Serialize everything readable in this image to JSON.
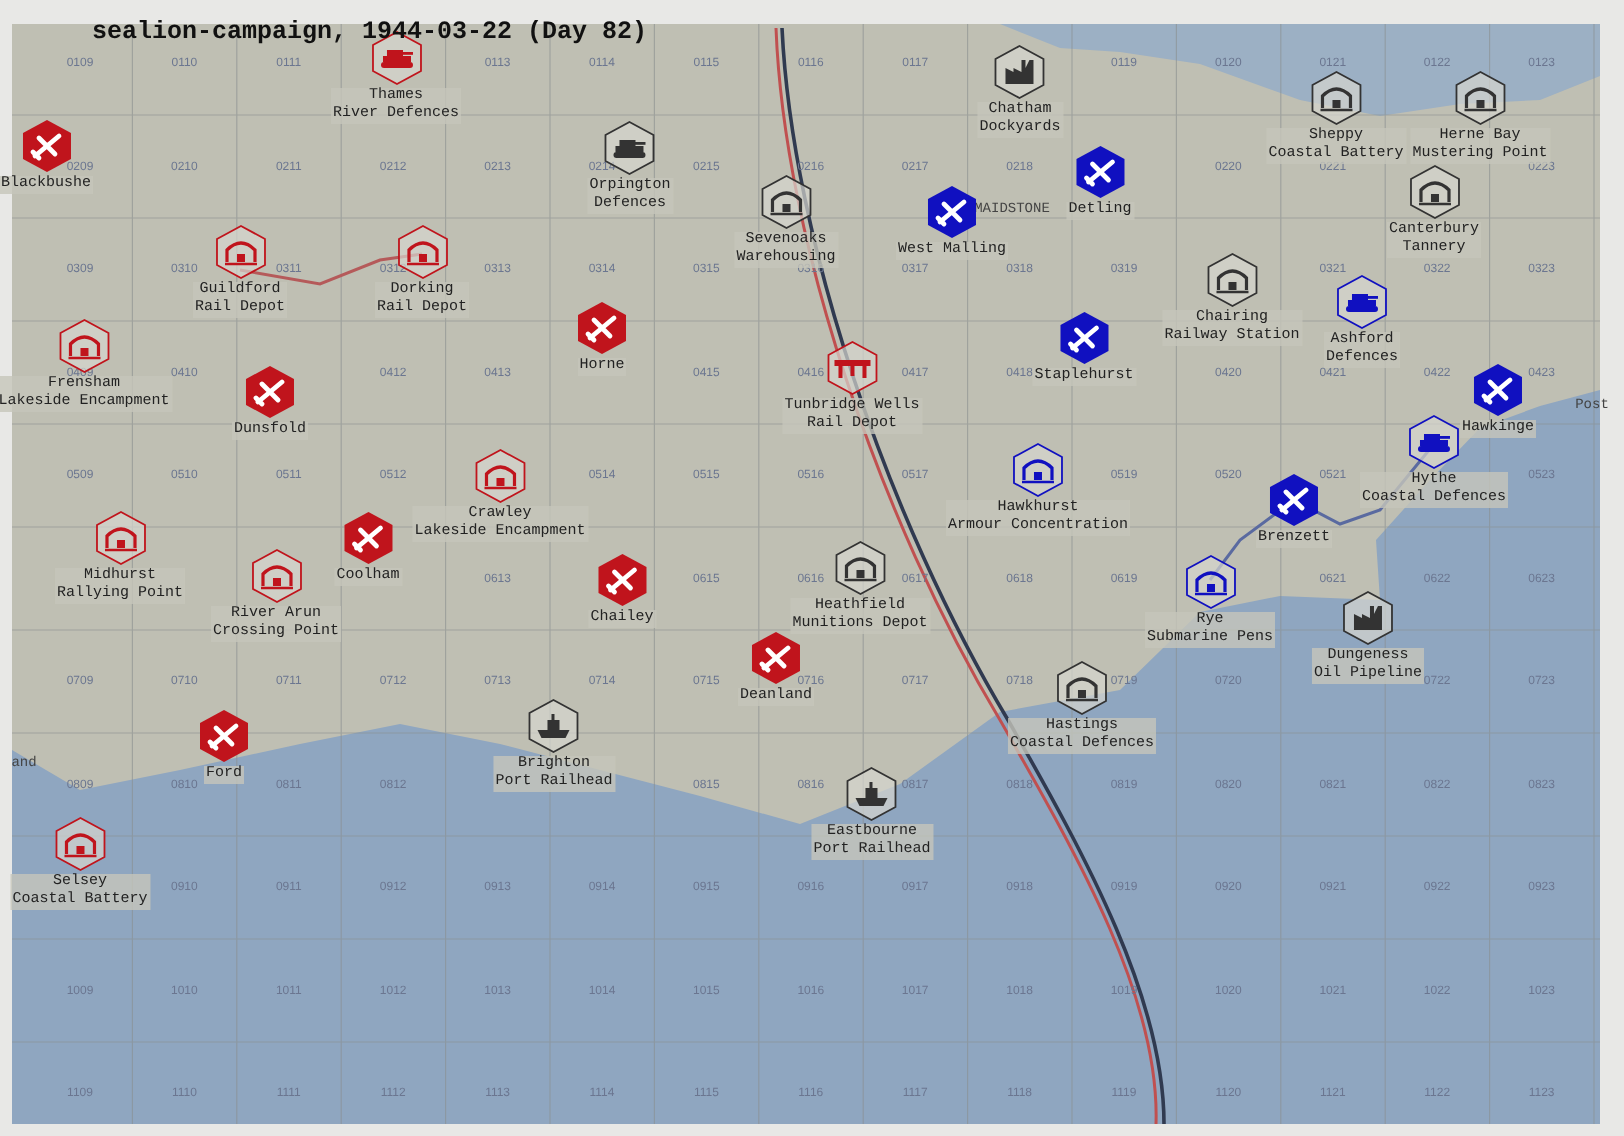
{
  "title": "sealion-campaign, 1944-03-22 (Day 82)",
  "grid_labels": [
    [
      "0109",
      "0110",
      "0111",
      "0113",
      "0114",
      "0115",
      "0116",
      "0117",
      "0119",
      "0120",
      "0121",
      "0122",
      "0123"
    ],
    [
      "0209",
      "0210",
      "0211",
      "0212",
      "0213",
      "0214",
      "0215",
      "0216",
      "0217",
      "0218",
      "0220",
      "0221",
      "0223"
    ],
    [
      "0309",
      "0310",
      "0311",
      "0312",
      "0313",
      "0314",
      "0315",
      "0316",
      "0317",
      "0318",
      "0319",
      "0321",
      "0322",
      "0323"
    ],
    [
      "0409",
      "0410",
      "0412",
      "0413",
      "0415",
      "0416",
      "0417",
      "0418",
      "0420",
      "0421",
      "0422",
      "0423"
    ],
    [
      "0509",
      "0510",
      "0511",
      "0512",
      "0514",
      "0515",
      "0516",
      "0517",
      "0519",
      "0520",
      "0521",
      "0523"
    ],
    [
      "0613",
      "0615",
      "0616",
      "0617",
      "0618",
      "0619",
      "0621",
      "0622",
      "0623"
    ],
    [
      "0709",
      "0710",
      "0711",
      "0712",
      "0713",
      "0714",
      "0715",
      "0716",
      "0717",
      "0718",
      "0719",
      "0720",
      "0722",
      "0723"
    ],
    [
      "0809",
      "0810",
      "0811",
      "0812",
      "0815",
      "0816",
      "0817",
      "0818",
      "0819",
      "0820",
      "0821",
      "0822",
      "0823"
    ],
    [
      "0910",
      "0911",
      "0912",
      "0913",
      "0914",
      "0915",
      "0916",
      "0917",
      "0918",
      "0919",
      "0920",
      "0921",
      "0922",
      "0923"
    ],
    [
      "1009",
      "1010",
      "1011",
      "1012",
      "1013",
      "1014",
      "1015",
      "1016",
      "1017",
      "1018",
      "1019",
      "1020",
      "1021",
      "1022",
      "1023"
    ],
    [
      "1109",
      "1110",
      "1111",
      "1112",
      "1113",
      "1114",
      "1115",
      "1116",
      "1117",
      "1118",
      "1119",
      "1120",
      "1121",
      "1122",
      "1123"
    ]
  ],
  "markers": [
    {
      "lines": [
        "Thames",
        "River Defences"
      ],
      "kind": "defences",
      "color": "#c0141c"
    },
    {
      "lines": [
        "Blackbushe"
      ],
      "kind": "airfield",
      "color": "#c0141c"
    },
    {
      "lines": [
        "Orpington",
        "Defences"
      ],
      "kind": "defences",
      "color": "#333333"
    },
    {
      "lines": [
        "Chatham",
        "Dockyards"
      ],
      "kind": "factory",
      "color": "#333333"
    },
    {
      "lines": [
        "Sheppy",
        "Coastal Battery"
      ],
      "kind": "camp",
      "color": "#333333"
    },
    {
      "lines": [
        "Herne Bay",
        "Mustering Point"
      ],
      "kind": "camp",
      "color": "#333333"
    },
    {
      "lines": [
        "Detling"
      ],
      "kind": "airfield",
      "color": "#1010c0"
    },
    {
      "lines": [
        "Sevenoaks",
        "Warehousing"
      ],
      "kind": "camp",
      "color": "#333333"
    },
    {
      "lines": [
        "West Malling"
      ],
      "kind": "airfield",
      "color": "#1010c0"
    },
    {
      "lines": [
        "Canterbury",
        "Tannery"
      ],
      "kind": "camp",
      "color": "#333333"
    },
    {
      "lines": [
        "Guildford",
        "Rail Depot"
      ],
      "kind": "camp",
      "color": "#c0141c"
    },
    {
      "lines": [
        "Dorking",
        "Rail Depot"
      ],
      "kind": "camp",
      "color": "#c0141c"
    },
    {
      "lines": [
        "Horne"
      ],
      "kind": "airfield",
      "color": "#c0141c"
    },
    {
      "lines": [
        "Chairing",
        "Railway Station"
      ],
      "kind": "camp",
      "color": "#333333"
    },
    {
      "lines": [
        "Ashford",
        "Defences"
      ],
      "kind": "defences",
      "color": "#1010c0"
    },
    {
      "lines": [
        "Frensham",
        "Lakeside Encampment"
      ],
      "kind": "camp",
      "color": "#c0141c"
    },
    {
      "lines": [
        "Dunsfold"
      ],
      "kind": "airfield",
      "color": "#c0141c"
    },
    {
      "lines": [
        "Staplehurst"
      ],
      "kind": "airfield",
      "color": "#1010c0"
    },
    {
      "lines": [
        "Tunbridge Wells",
        "Rail Depot"
      ],
      "kind": "bridge",
      "color": "#c0141c"
    },
    {
      "lines": [
        "Hawkinge"
      ],
      "kind": "airfield",
      "color": "#1010c0"
    },
    {
      "lines": [
        "Hythe",
        "Coastal Defences"
      ],
      "kind": "defences",
      "color": "#1010c0"
    },
    {
      "lines": [
        "Crawley",
        "Lakeside Encampment"
      ],
      "kind": "camp",
      "color": "#c0141c"
    },
    {
      "lines": [
        "Hawkhurst",
        "Armour Concentration"
      ],
      "kind": "camp",
      "color": "#1010c0"
    },
    {
      "lines": [
        "Brenzett"
      ],
      "kind": "airfield",
      "color": "#1010c0"
    },
    {
      "lines": [
        "Midhurst",
        "Rallying Point"
      ],
      "kind": "camp",
      "color": "#c0141c"
    },
    {
      "lines": [
        "Coolham"
      ],
      "kind": "airfield",
      "color": "#c0141c"
    },
    {
      "lines": [
        "River Arun",
        "Crossing Point"
      ],
      "kind": "camp",
      "color": "#c0141c"
    },
    {
      "lines": [
        "Chailey"
      ],
      "kind": "airfield",
      "color": "#c0141c"
    },
    {
      "lines": [
        "Heathfield",
        "Munitions Depot"
      ],
      "kind": "camp",
      "color": "#333333"
    },
    {
      "lines": [
        "Rye",
        "Submarine Pens"
      ],
      "kind": "camp",
      "color": "#1010c0"
    },
    {
      "lines": [
        "Dungeness",
        "Oil Pipeline"
      ],
      "kind": "factory",
      "color": "#333333"
    },
    {
      "lines": [
        "Deanland"
      ],
      "kind": "airfield",
      "color": "#c0141c"
    },
    {
      "lines": [
        "Hastings",
        "Coastal Defences"
      ],
      "kind": "camp",
      "color": "#333333"
    },
    {
      "lines": [
        "Ford"
      ],
      "kind": "airfield",
      "color": "#c0141c"
    },
    {
      "lines": [
        "Brighton",
        "Port Railhead"
      ],
      "kind": "ship",
      "color": "#333333"
    },
    {
      "lines": [
        "Eastbourne",
        "Port Railhead"
      ],
      "kind": "ship",
      "color": "#333333"
    },
    {
      "lines": [
        "Selsey",
        "Coastal Battery"
      ],
      "kind": "camp",
      "color": "#c0141c"
    }
  ],
  "place_labels": [
    "MAIDSTONE",
    "Post",
    "and"
  ]
}
